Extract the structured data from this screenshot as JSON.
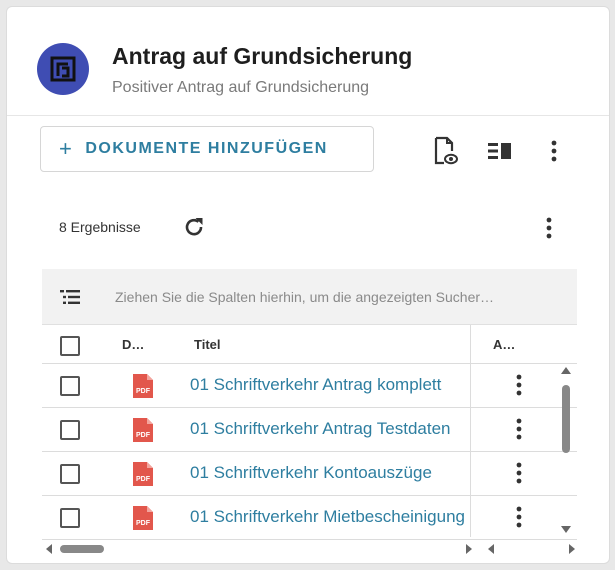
{
  "header": {
    "title": "Antrag auf Grundsicherung",
    "subtitle": "Positiver Antrag auf Grundsicherung",
    "avatar_icon": "document-frame-icon",
    "avatar_color": "#3f4db3"
  },
  "toolbar": {
    "add_label": "DOKUMENTE HINZUFÜGEN",
    "add_icon": "plus-icon",
    "preview_icon": "document-preview-icon",
    "columns_icon": "column-panel-icon",
    "menu_icon": "more-vertical-icon"
  },
  "results": {
    "label": "8 Ergebnisse",
    "refresh_icon": "refresh-icon",
    "menu_icon": "more-vertical-icon"
  },
  "grid": {
    "group_placeholder": "Ziehen Sie die Spalten hierhin, um die angezeigten Sucher…",
    "columns": [
      "D…",
      "Titel",
      "A…"
    ],
    "rows": [
      {
        "type": "PDF",
        "title": "01 Schriftverkehr Antrag komplett"
      },
      {
        "type": "PDF",
        "title": "01 Schriftverkehr Antrag Testdaten"
      },
      {
        "type": "PDF",
        "title": "01 Schriftverkehr Kontoauszüge"
      },
      {
        "type": "PDF",
        "title": "01 Schriftverkehr Mietbescheinigung"
      }
    ]
  },
  "colors": {
    "accent": "#2e7ea0",
    "pdf": "#e2574c"
  }
}
